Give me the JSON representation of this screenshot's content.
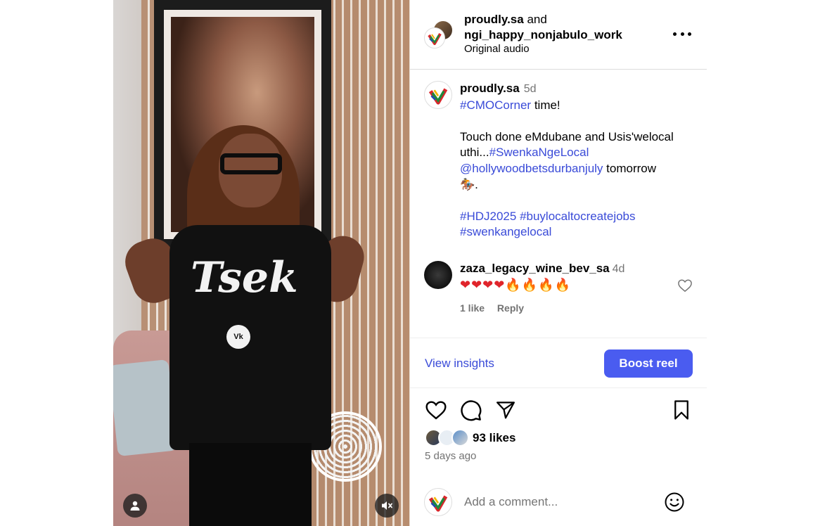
{
  "header": {
    "author": "proudly.sa",
    "and_text": "and",
    "collaborator": "ngi_happy_nonjabulo_work",
    "audio": "Original audio"
  },
  "caption": {
    "username": "proudly.sa",
    "time": "5d",
    "line1_tag": "#CMOCorner",
    "line1_text": " time!",
    "line2": "Touch done eMdubane and Usis'welocal uthi...",
    "line2_tag": "#SwenkaNgeLocal",
    "mention": "@hollywoodbetsdurbanjuly",
    "mention_after": " tomorrow",
    "horse_emoji": "🏇",
    "period": ".",
    "tags": [
      "#HDJ2025",
      "#buylocaltocreatejobs",
      "#swenkangelocal"
    ]
  },
  "comment": {
    "username": "zaza_legacy_wine_bev_sa",
    "time": "4d",
    "hearts": "❤❤❤❤",
    "fires": "🔥🔥🔥🔥",
    "likes": "1 like",
    "reply": "Reply"
  },
  "insights": {
    "view_label": "View insights",
    "boost_label": "Boost reel"
  },
  "post_meta": {
    "likes": "93 likes",
    "date": "5 days ago"
  },
  "add_comment": {
    "placeholder": "Add a comment..."
  },
  "media": {
    "shirt_text": "Tsek",
    "shirt_logo": "Vk"
  },
  "colors": {
    "link": "#3a4bd8",
    "boost": "#4a5cf0",
    "muted": "#737373"
  }
}
